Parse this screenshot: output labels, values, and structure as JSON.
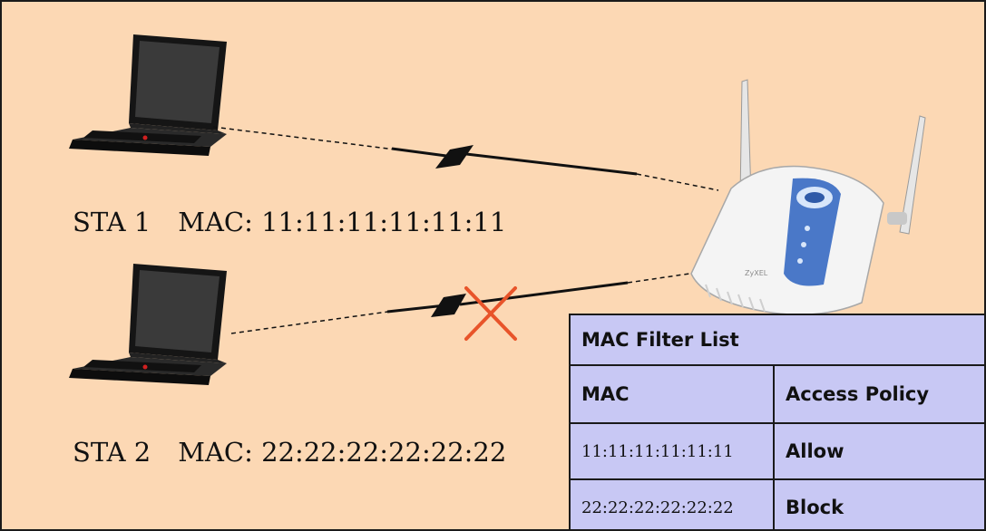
{
  "stations": [
    {
      "name": "STA 1",
      "mac_text": "MAC: 11:11:11:11:11:11",
      "connection": "allowed"
    },
    {
      "name": "STA 2",
      "mac_text": "MAC: 22:22:22:22:22:22",
      "connection": "blocked"
    }
  ],
  "access_point": {
    "brand_text": "ZyXEL"
  },
  "mac_filter_table": {
    "title": "MAC Filter List",
    "headers": [
      "MAC",
      "Access Policy"
    ],
    "rows": [
      {
        "mac": "11:11:11:11:11:11",
        "policy": "Allow"
      },
      {
        "mac": "22:22:22:22:22:22",
        "policy": "Block"
      }
    ]
  },
  "colors": {
    "background": "#fcd8b4",
    "table_background": "#c8c8f4",
    "block_mark": "#e8542a",
    "ap_accent": "#4a78c8"
  }
}
